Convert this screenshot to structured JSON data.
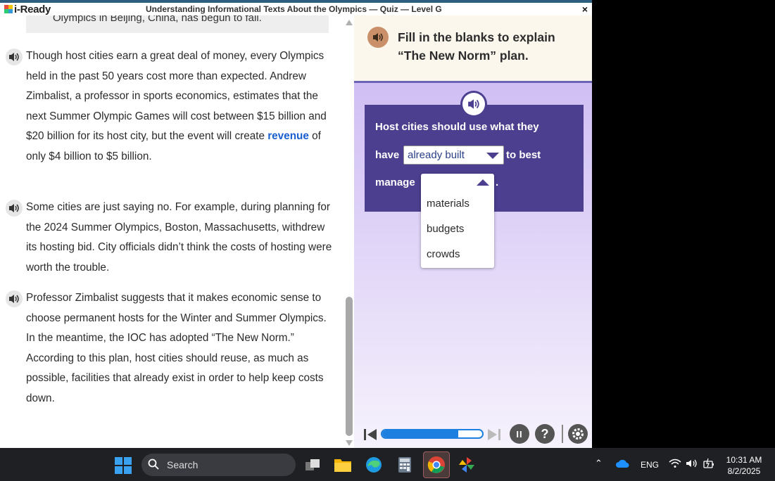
{
  "app": {
    "logo_text": "i-Ready",
    "window_title": "Understanding Informational Texts About the Olympics — Quiz — Level G",
    "close_symbol": "×",
    "brand_color": "#4c3f8f"
  },
  "passage": {
    "cutoff_line": "Olympics in Beijing, China, has begun to fail.",
    "p1_before": "Though host cities earn a great deal of money, every Olympics held in the past 50 years cost more than expected. Andrew Zimbalist, a professor in sports economics, estimates that the next Summer Olympic Games will cost between $15 billion and $20 billion for its host city, but the event will create ",
    "p1_vocab": "revenue",
    "p1_after": " of only $4 billion to $5 billion.",
    "p2": "Some cities are just saying no. For example, during planning for the 2024 Summer Olympics, Boston, Massachusetts, withdrew its hosting bid. City officials didn’t think the costs of hosting were worth the trouble.",
    "p3": "Professor Zimbalist suggests that it makes economic sense to choose permanent hosts for the Winter and Summer Olympics. In the meantime, the IOC has adopted “The New Norm.” According to this plan, host cities should reuse, as much as possible, facilities that already exist in order to help keep costs down."
  },
  "question": {
    "prompt": "Fill in the blanks to explain “The New Norm” plan.",
    "sentence_line1": "Host cities should use what they",
    "word_have": "have",
    "word_to_best": "to best",
    "word_manage": "manage",
    "period": ".",
    "dropdown1": {
      "selected": "already built"
    },
    "dropdown2": {
      "selected": "",
      "options": [
        "materials",
        "budgets",
        "crowds"
      ]
    }
  },
  "player": {
    "progress": 0.76,
    "pause_label": "II",
    "help_label": "?"
  },
  "taskbar": {
    "search_label": "Search",
    "language": "ENG",
    "time": "10:31 AM",
    "date": "8/2/2025"
  }
}
